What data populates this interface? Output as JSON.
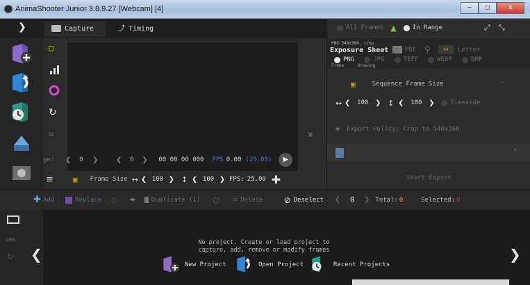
{
  "window": {
    "title": "AnimaShooter Junior 3.8.9.27 [Webcam] [4]",
    "min_label": "–",
    "max_label": "□",
    "close_label": "x"
  },
  "tabs": {
    "expand": "❯",
    "capture": "Capture",
    "timing": "Timing"
  },
  "frame_controls": {
    "frame_label": "ge:",
    "frame_value": "0",
    "step_value": "0",
    "timecode": "00 00 00 000",
    "fps_label": "FPS",
    "fps_value": "0.00",
    "fps_target": "(25.00)"
  },
  "size_row": {
    "frame_size_label": "Frame Size",
    "width": "100",
    "height": "100",
    "fps_label": "FPS:",
    "fps_value": "25.00"
  },
  "right_panel": {
    "all_frames": "All Frames",
    "in_range": "In Range",
    "export_small": "PNG 540x360, crop",
    "exposure_sheet": "Exposure Sheet",
    "pdf": "PDF",
    "letter_small": "Letter",
    "formats": [
      "PNG",
      "JPG",
      "TIFF",
      "WEBP",
      "BMP"
    ],
    "sub_frame": "Frame",
    "sub_drawing": "Drawing",
    "sequence_frame_size": "Sequence Frame Size",
    "seq_width": "100",
    "seq_height": "100",
    "timecode_label": "Timecode",
    "export_policy": "Export Policy: Crop to 540x360",
    "start_export": "Start Export"
  },
  "action_bar": {
    "add": "Add",
    "replace": "Replace",
    "duplicate": "Duplicate (1)",
    "delete": "Delete",
    "deselect": "Deselect",
    "counter": "0",
    "total_label": "Total:",
    "total_value": "0",
    "selected_label": "Selected:",
    "selected_value": "0"
  },
  "timeline": {
    "zoom": "100%",
    "message_line1": "No project. Create or load project to",
    "message_line2": "capture, add, remove or modify frames",
    "new_project": "New Project",
    "open_project": "Open Project",
    "recent_projects": "Recent Projects"
  },
  "colors": {
    "accent_blue": "#3b7ad1",
    "fps_blue": "#4a7de0",
    "warning_yellow": "#e2c000",
    "delete_red": "#d63a3a"
  }
}
